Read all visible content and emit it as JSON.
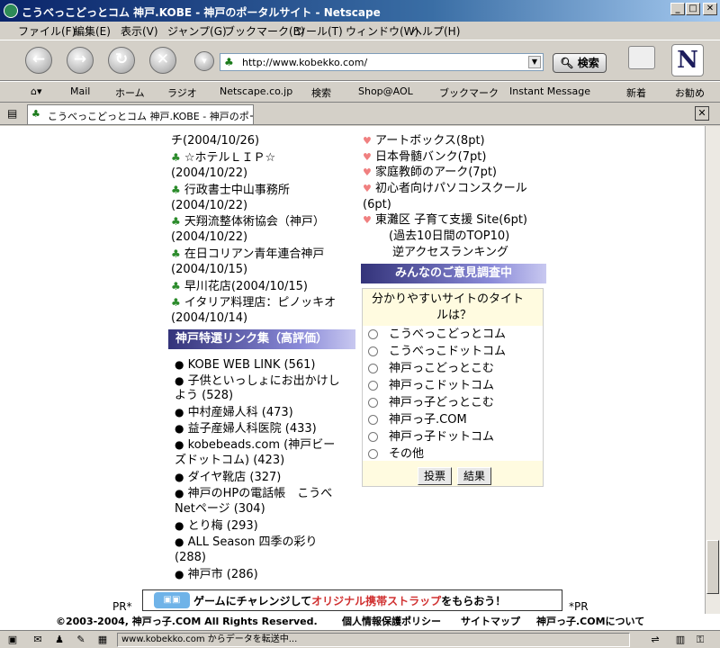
{
  "window": {
    "title": "こうべっこどっとコム 神戸.KOBE - 神戸のポータルサイト - Netscape",
    "min": "_",
    "max": "□",
    "close": "✕"
  },
  "menu": [
    "ファイル(F)",
    "編集(E)",
    "表示(V)",
    "ジャンプ(G)",
    "ブックマーク(B)",
    "ツール(T)",
    "ウィンドウ(W)",
    "ヘルプ(H)"
  ],
  "nav": {
    "back_icon": "arrow-left-icon",
    "url": "http://www.kobekko.com/",
    "search_label": "検索"
  },
  "bookmarks": [
    "Mail",
    "ホーム",
    "ラジオ",
    "Netscape.co.jp",
    "検索",
    "Shop@AOL",
    "ブックマーク",
    "Instant Message",
    "新着",
    "お勧め"
  ],
  "tab": {
    "title": "こうべっこどっとコム 神戸.KOBE - 神戸のポー..."
  },
  "left_new_sites": [
    {
      "text": "チ(2004/10/26)",
      "icon": false
    },
    {
      "text": "☆ホテルＬＩＰ☆",
      "icon": true
    },
    {
      "text": "(2004/10/22)",
      "icon": false
    },
    {
      "text": "行政書士中山事務所",
      "icon": true
    },
    {
      "text": "(2004/10/22)",
      "icon": false
    },
    {
      "text": "天翔流整体術協会（神戸）",
      "icon": true
    },
    {
      "text": "(2004/10/22)",
      "icon": false
    },
    {
      "text": "在日コリアン青年連合神戸",
      "icon": true
    },
    {
      "text": "(2004/10/15)",
      "icon": false
    },
    {
      "text": "早川花店(2004/10/15)",
      "icon": true
    },
    {
      "text": "イタリア料理店：ピノッキオ",
      "icon": true
    },
    {
      "text": "(2004/10/14)",
      "icon": false
    }
  ],
  "links_section": {
    "title": "神戸特選リンク集（高評価）",
    "items": [
      {
        "text": "KOBE WEB LINK (561)",
        "bullet": true
      },
      {
        "text": "子供といっしょにお出かけし",
        "bullet": true
      },
      {
        "text": "よう (528)",
        "bullet": false
      },
      {
        "text": "中村産婦人科 (473)",
        "bullet": true
      },
      {
        "text": "益子産婦人科医院 (433)",
        "bullet": true
      },
      {
        "text": "kobebeads.com (神戸ビー",
        "bullet": true
      },
      {
        "text": "ズドットコム) (423)",
        "bullet": false
      },
      {
        "text": "ダイヤ靴店 (327)",
        "bullet": true
      },
      {
        "text": "神戸のHPの電話帳　こうべ",
        "bullet": true
      },
      {
        "text": "Netページ (304)",
        "bullet": false
      },
      {
        "text": "とり梅 (293)",
        "bullet": true
      },
      {
        "text": "ALL Season 四季の彩り",
        "bullet": true
      },
      {
        "text": "(288)",
        "bullet": false
      },
      {
        "text": "神戸市 (286)",
        "bullet": true
      }
    ]
  },
  "right_ranking": [
    {
      "text": "アートボックス(8pt)",
      "icon": true
    },
    {
      "text": "日本骨髄バンク(7pt)",
      "icon": true
    },
    {
      "text": "家庭教師のアーク(7pt)",
      "icon": true
    },
    {
      "text": "初心者向けパソコンスクール",
      "icon": true
    },
    {
      "text": "(6pt)",
      "icon": false
    },
    {
      "text": "東灘区 子育て支援 Site(6pt)",
      "icon": true
    }
  ],
  "ranking_caption": "(過去10日間のTOP10)",
  "reverse_access": "逆アクセスランキング",
  "poll": {
    "title": "みんなのご意見調査中",
    "question_1": "分かりやすいサイトのタイト",
    "question_2": "ルは？",
    "options": [
      "こうべっこどっとコム",
      "こうべっこドットコム",
      "神戸っこどっとこむ",
      "神戸っこドットコム",
      "神戸っ子どっとこむ",
      "神戸っ子.COM",
      "神戸っ子ドットコム",
      "その他"
    ],
    "vote": "投票",
    "results": "結果"
  },
  "banner": {
    "pr_left": "PR*",
    "pr_right": "*PR",
    "text_a": "ゲームにチャレンジして",
    "text_b": "オリジナル携帯ストラップ",
    "text_c": "をもらおう！"
  },
  "footer": {
    "copyright": "©2003-2004, 神戸っ子.COM  All Rights Reserved.",
    "privacy": "個人情報保護ポリシー",
    "sitemap": "サイトマップ",
    "about": "神戸っ子.COMについて"
  },
  "status": {
    "text": "www.kobekko.com からデータを転送中..."
  }
}
